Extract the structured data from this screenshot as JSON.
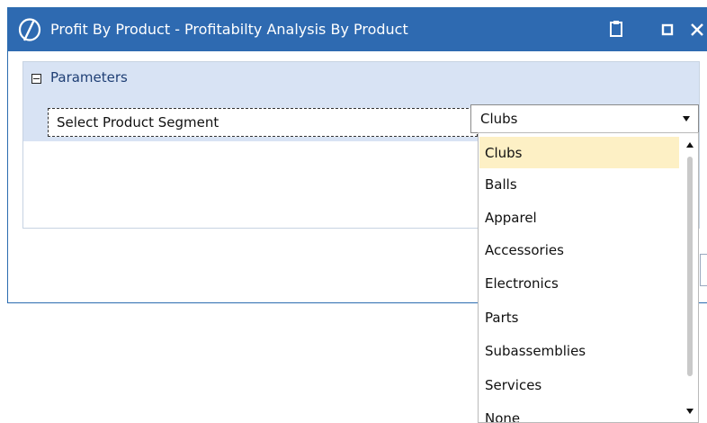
{
  "window": {
    "title": "Profit By Product - Profitabilty Analysis By Product",
    "icons": [
      "app-logo-icon",
      "clipboard-icon",
      "maximize-icon",
      "close-icon"
    ]
  },
  "parameters": {
    "section_label": "Parameters",
    "field_label": "Select Product Segment",
    "selected_value": "Clubs"
  },
  "dropdown": {
    "options": [
      "Clubs",
      "Balls",
      "Apparel",
      "Accessories",
      "Electronics",
      "Parts",
      "Subassemblies",
      "Services",
      "None"
    ],
    "highlighted": "Clubs"
  },
  "colors": {
    "titlebar": "#2e6ab1",
    "params_background": "#d8e3f4",
    "highlight": "#fdf0c5"
  }
}
